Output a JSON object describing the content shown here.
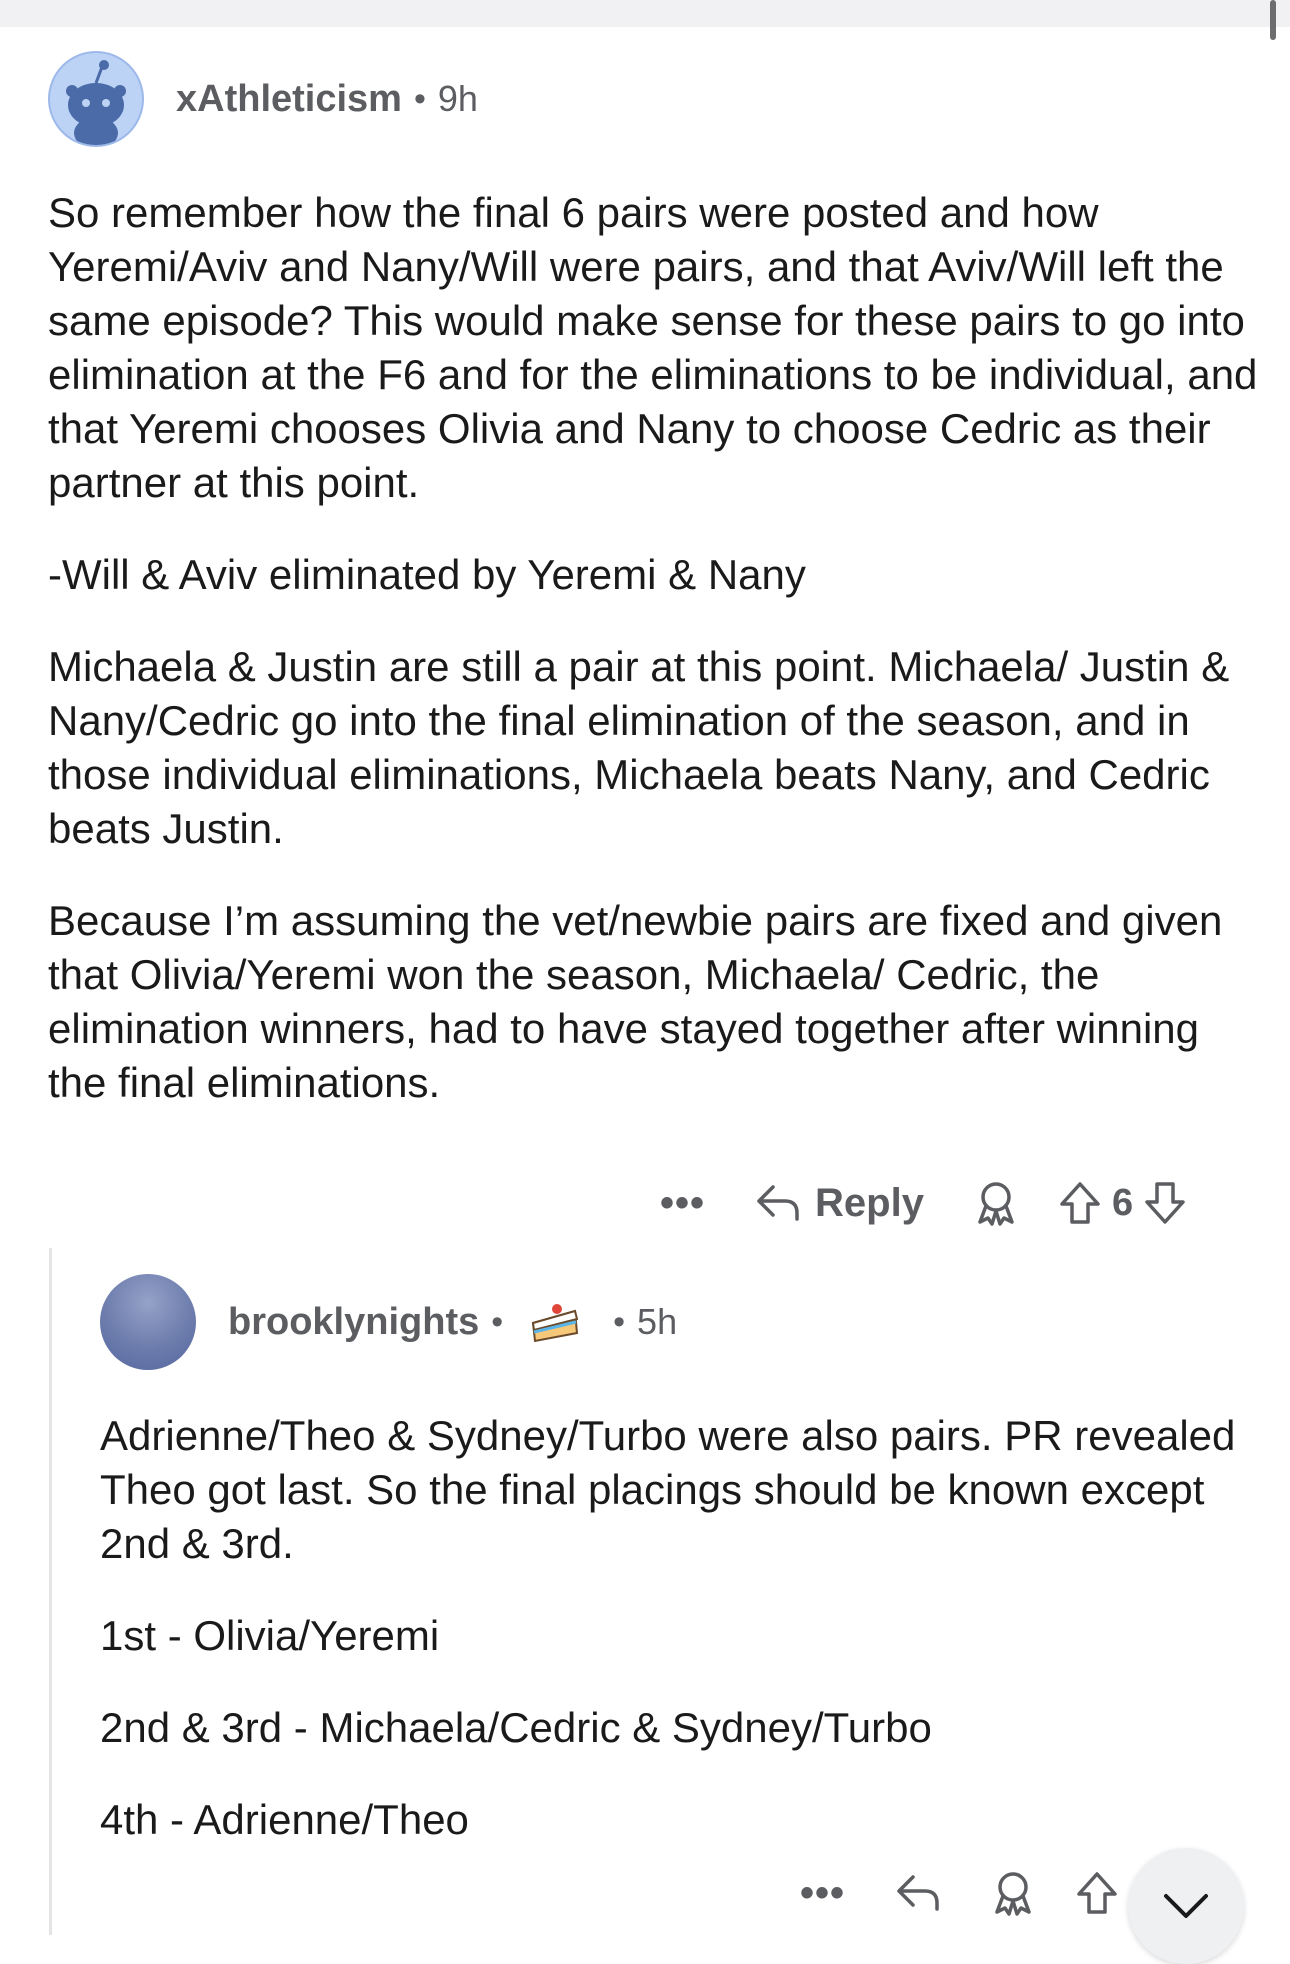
{
  "comments": [
    {
      "username": "xAthleticism",
      "separator": "•",
      "age": "9h",
      "paragraphs": [
        "So remember how the final 6 pairs were posted and how Yeremi/Aviv and Nany/Will were pairs, and that Aviv/Will left the same episode? This would make sense for these pairs to go into elimination at the F6 and for the eliminations to be individual, and that Yeremi chooses Olivia and Nany to choose Cedric as their partner at this point.",
        "-Will & Aviv eliminated by Yeremi & Nany",
        "Michaela & Justin are still a pair at this point. Michaela/ Justin & Nany/Cedric go into the final elimination of the season, and in those individual eliminations, Michaela beats Nany, and Cedric beats Justin.",
        "Because I’m assuming the vet/newbie pairs are fixed and given that Olivia/Yeremi won the season, Michaela/ Cedric, the elimination winners, had to have stayed together after winning the final eliminations."
      ],
      "actions": {
        "more": "•••",
        "reply": "Reply",
        "votes": "6"
      }
    },
    {
      "username": "brooklynights",
      "separator": "•",
      "age": "5h",
      "badge": "cake-day-icon",
      "paragraphs": [
        "Adrienne/Theo & Sydney/Turbo were also pairs. PR revealed Theo got last. So the final placings should be known except 2nd & 3rd.",
        "1st - Olivia/Yeremi",
        "2nd & 3rd - Michaela/Cedric & Sydney/Turbo",
        "4th - Adrienne/Theo"
      ],
      "actions": {
        "more": "•••"
      }
    }
  ],
  "icons": {
    "reply": "reply-arrow-icon",
    "award": "award-icon",
    "upvote": "upvote-arrow-icon",
    "downvote": "downvote-arrow-icon",
    "scroll": "chevron-down-icon"
  },
  "colors": {
    "meta_text": "#5b5d61",
    "body_text": "#1a1a1b",
    "thread_line": "#e3e4e6"
  }
}
